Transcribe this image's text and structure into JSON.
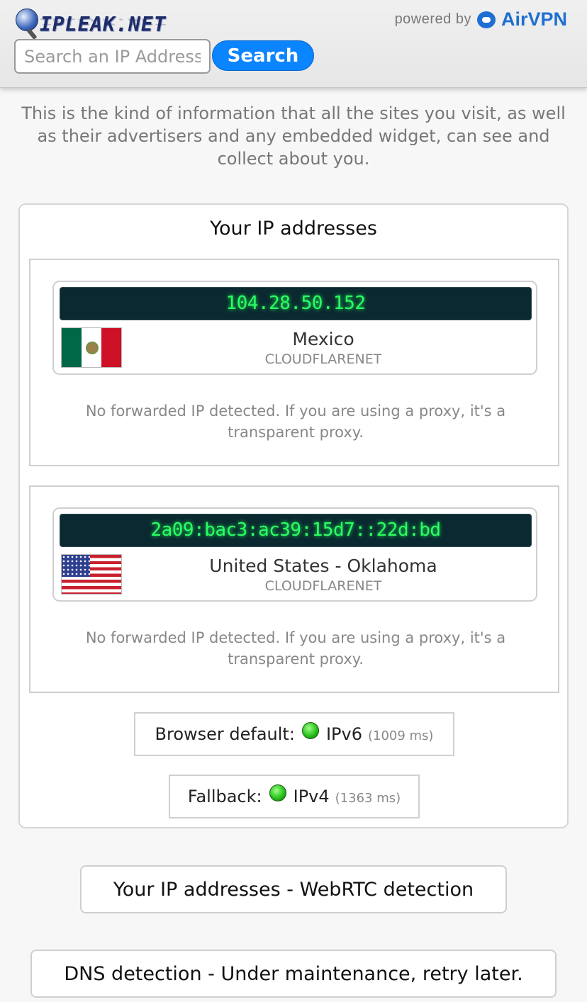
{
  "header": {
    "logo_text": "IPLEAK.NET",
    "powered_by": "powered by",
    "brand": "AirVPN",
    "search_placeholder": "Search an IP Address",
    "search_button": "Search"
  },
  "intro": "This is the kind of information that all the sites you visit, as well as their advertisers and any embedded widget, can see and collect about you.",
  "ip_panel": {
    "title": "Your IP addresses",
    "entries": [
      {
        "ip": "104.28.50.152",
        "country": "Mexico",
        "isp": "CLOUDFLARENET",
        "flag": "mexico-flag",
        "note": "No forwarded IP detected. If you are using a proxy, it's a transparent proxy."
      },
      {
        "ip": "2a09:bac3:ac39:15d7::22d:bd",
        "country": "United States - Oklahoma",
        "isp": "CLOUDFLARENET",
        "flag": "usa-flag",
        "note": "No forwarded IP detected. If you are using a proxy, it's a transparent proxy."
      }
    ],
    "browser_default": {
      "label": "Browser default:",
      "protocol": "IPv6",
      "time": "(1009 ms)",
      "status_color": "#27c21b"
    },
    "fallback": {
      "label": "Fallback:",
      "protocol": "IPv4",
      "time": "(1363 ms)",
      "status_color": "#27c21b"
    }
  },
  "buttons": {
    "webrtc": "Your IP addresses - WebRTC detection",
    "dns": "DNS detection - Under maintenance, retry later."
  },
  "colors": {
    "accent": "#0a84ff",
    "brand": "#1e6fd1",
    "ip_text": "#2cff64",
    "ip_bg": "#0a2930"
  }
}
